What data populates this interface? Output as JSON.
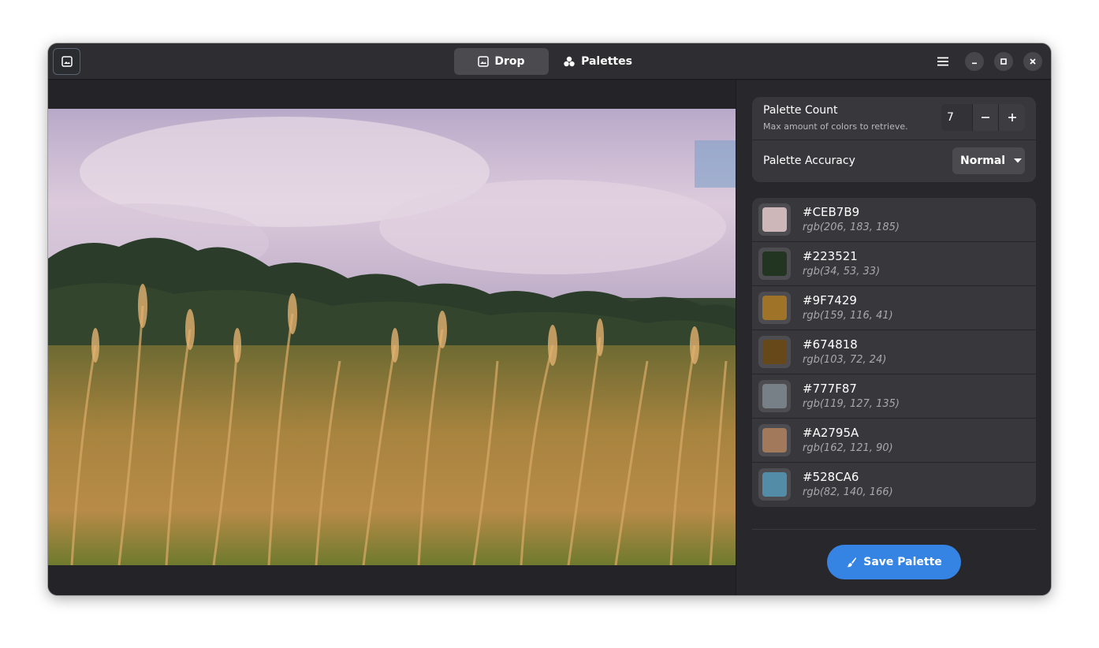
{
  "header": {
    "open_image_icon": "image-icon",
    "tabs": [
      {
        "label": "Drop",
        "icon": "image-icon",
        "active": true
      },
      {
        "label": "Palettes",
        "icon": "palette-icon",
        "active": false
      }
    ],
    "menu_icon": "hamburger-menu-icon",
    "window_controls": [
      "minimize-icon",
      "maximize-icon",
      "close-icon"
    ]
  },
  "settings": {
    "count_title": "Palette Count",
    "count_subtitle": "Max amount of colors to retrieve.",
    "count_value": "7",
    "accuracy_title": "Palette Accuracy",
    "accuracy_value": "Normal"
  },
  "colors": [
    {
      "hex": "#CEB7B9",
      "rgb": "rgb(206, 183, 185)"
    },
    {
      "hex": "#223521",
      "rgb": "rgb(34, 53, 33)"
    },
    {
      "hex": "#9F7429",
      "rgb": "rgb(159, 116, 41)"
    },
    {
      "hex": "#674818",
      "rgb": "rgb(103, 72, 24)"
    },
    {
      "hex": "#777F87",
      "rgb": "rgb(119, 127, 135)"
    },
    {
      "hex": "#A2795A",
      "rgb": "rgb(162, 121, 90)"
    },
    {
      "hex": "#528CA6",
      "rgb": "rgb(82, 140, 166)"
    }
  ],
  "save_label": "Save Palette",
  "accent_color": "#3584e4"
}
